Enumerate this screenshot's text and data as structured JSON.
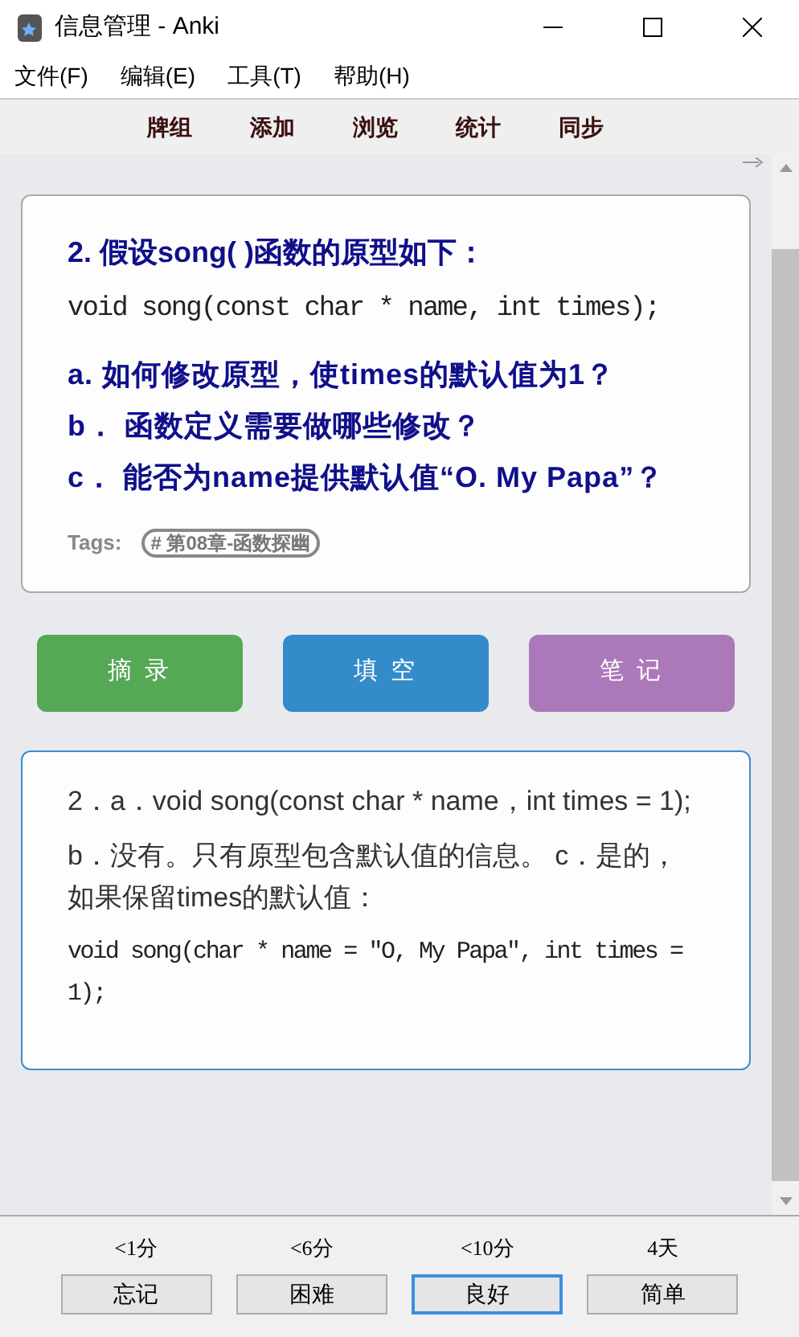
{
  "window": {
    "title": "信息管理 - Anki"
  },
  "menu": [
    "文件(F)",
    "编辑(E)",
    "工具(T)",
    "帮助(H)"
  ],
  "toolbar": [
    "牌组",
    "添加",
    "浏览",
    "统计",
    "同步"
  ],
  "question": {
    "lines": [
      {
        "kind": "heading",
        "text": "2. 假设song( )函数的原型如下："
      },
      {
        "kind": "code",
        "text": "void song(const char * name, int times);"
      },
      {
        "kind": "item",
        "text": "a. 如何修改原型，使times的默认值为1？"
      },
      {
        "kind": "item",
        "text": "b． 函数定义需要做哪些修改？"
      },
      {
        "kind": "item",
        "text": "c． 能否为name提供默认值“O. My Papa”？"
      }
    ],
    "tags_label": "Tags:",
    "tags": [
      "# 第08章-函数探幽"
    ]
  },
  "actions": [
    {
      "label": "摘 录",
      "color": "#55a854"
    },
    {
      "label": "填 空",
      "color": "#348bc9"
    },
    {
      "label": "笔 记",
      "color": "#ab78ba"
    }
  ],
  "answer": {
    "lines": [
      {
        "kind": "text",
        "text": "2．a．void song(const char * name，int times = 1);"
      },
      {
        "kind": "text",
        "text": "b．没有。只有原型包含默认值的信息。 c．是的，如果保留times的默认值："
      },
      {
        "kind": "code",
        "text": "void song(char * name = \"O, My Papa\", int times = 1);"
      }
    ]
  },
  "answer_buttons": [
    {
      "interval": "<1分",
      "label": "忘记",
      "selected": false
    },
    {
      "interval": "<6分",
      "label": "困难",
      "selected": false
    },
    {
      "interval": "<10分",
      "label": "良好",
      "selected": true
    },
    {
      "interval": "4天",
      "label": "简单",
      "selected": false
    }
  ]
}
